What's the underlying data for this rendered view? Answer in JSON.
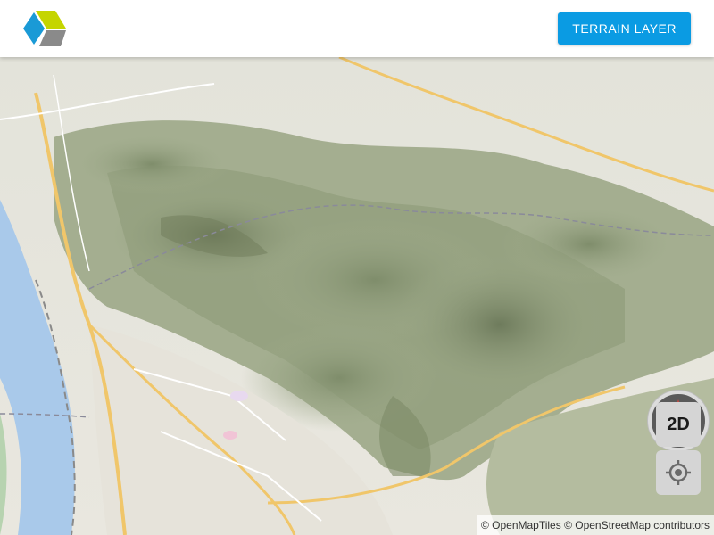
{
  "header": {
    "terrain_button_label": "TERRAIN LAYER"
  },
  "controls": {
    "mode_button_label": "2D"
  },
  "attribution": {
    "openmaptiles": "© OpenMapTiles",
    "openstreetmap": "© OpenStreetMap contributors"
  },
  "colors": {
    "accent": "#0a9be3",
    "logo_yellow": "#c5d500",
    "logo_blue": "#1a9ad6",
    "logo_gray": "#8a8a8a",
    "water": "#a9c9ea",
    "forest": "#9aa98a",
    "compass_north": "#e8453c"
  },
  "icons": {
    "logo": "app-logo",
    "compass": "compass-icon",
    "locate": "locate-icon"
  }
}
